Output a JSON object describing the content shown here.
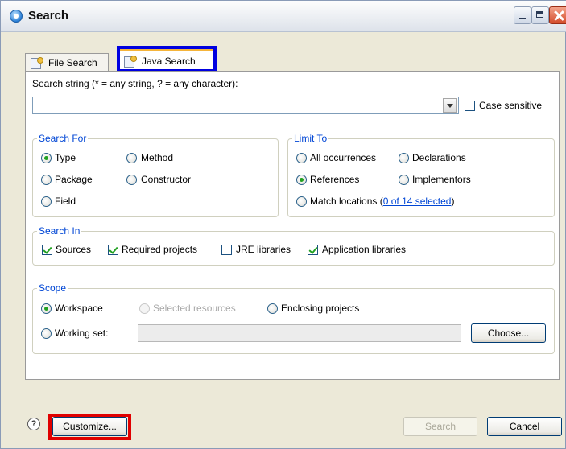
{
  "window": {
    "title": "Search"
  },
  "tabs": [
    {
      "label": "File Search"
    },
    {
      "label": "Java Search"
    }
  ],
  "search_string": {
    "label": "Search string (* = any string, ? = any character):",
    "value": ""
  },
  "case_sensitive": {
    "label": "Case sensitive",
    "checked": false
  },
  "search_for": {
    "title": "Search For",
    "options": [
      {
        "label": "Type",
        "selected": true
      },
      {
        "label": "Method",
        "selected": false
      },
      {
        "label": "Package",
        "selected": false
      },
      {
        "label": "Constructor",
        "selected": false
      },
      {
        "label": "Field",
        "selected": false
      }
    ]
  },
  "limit_to": {
    "title": "Limit To",
    "options": [
      {
        "label": "All occurrences",
        "selected": false
      },
      {
        "label": "Declarations",
        "selected": false
      },
      {
        "label": "References",
        "selected": true
      },
      {
        "label": "Implementors",
        "selected": false
      },
      {
        "label": "Match locations",
        "selected": false
      }
    ],
    "match_link": "0 of 14 selected",
    "paren_open": "(",
    "paren_close": ")"
  },
  "search_in": {
    "title": "Search In",
    "options": [
      {
        "label": "Sources",
        "checked": true
      },
      {
        "label": "Required projects",
        "checked": true
      },
      {
        "label": "JRE libraries",
        "checked": false
      },
      {
        "label": "Application libraries",
        "checked": true
      }
    ]
  },
  "scope": {
    "title": "Scope",
    "options": [
      {
        "label": "Workspace",
        "selected": true
      },
      {
        "label": "Selected resources",
        "selected": false,
        "disabled": true
      },
      {
        "label": "Enclosing projects",
        "selected": false
      },
      {
        "label": "Working set:",
        "selected": false
      }
    ],
    "working_set_value": "",
    "choose_label": "Choose..."
  },
  "footer": {
    "help_glyph": "?",
    "customize_label": "Customize...",
    "search_label": "Search",
    "cancel_label": "Cancel"
  },
  "colors": {
    "group_title": "#0046d5",
    "highlight_blue": "#0000e0",
    "highlight_red": "#e00000",
    "radio_dot": "#21a121"
  }
}
